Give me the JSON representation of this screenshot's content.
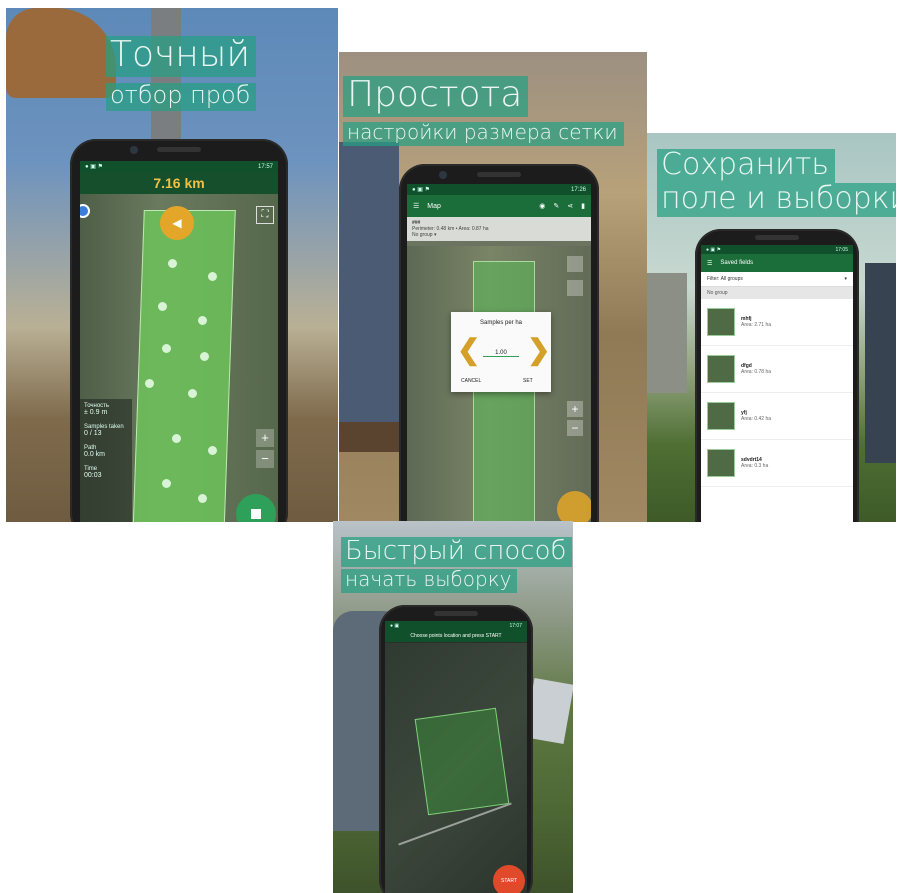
{
  "panel1": {
    "title_line1": "Точный",
    "title_line2": "отбор проб",
    "status_time": "17:57",
    "distance": "7.16 km",
    "stats": [
      {
        "label": "Точность",
        "value": "± 0.9 m"
      },
      {
        "label": "Samples taken",
        "value": "0 / 13"
      },
      {
        "label": "Path",
        "value": "0.0 km"
      },
      {
        "label": "Time",
        "value": "00:03"
      }
    ],
    "zoom_in": "+",
    "zoom_out": "−"
  },
  "panel2": {
    "title_line1": "Простота",
    "title_line2": "настройки размера сетки",
    "status_time": "17:26",
    "appbar_title": "Map",
    "info_name": "###",
    "info_line": "Perimeter: 0.48 km • Area: 0.87 ha",
    "info_group": "No group ▾",
    "dialog_title": "Samples per ha",
    "dialog_value": "1.00",
    "dialog_cancel": "CANCEL",
    "dialog_set": "SET",
    "zoom_in": "+",
    "zoom_out": "−"
  },
  "panel3": {
    "title_line1": "Сохранить",
    "title_line2": "поле и выборки",
    "status_time": "17:05",
    "appbar_title": "Saved fields",
    "filter_label": "Filter:",
    "filter_value": "All groups",
    "group_header": "No group",
    "fields": [
      {
        "name": "mhfj",
        "area": "Area: 2.71 ha"
      },
      {
        "name": "dfgd",
        "area": "Area: 0.78 ha"
      },
      {
        "name": "yfj",
        "area": "Area: 0.42 ha"
      },
      {
        "name": "sdvdrt14",
        "area": "Area: 0.3 ha"
      }
    ]
  },
  "panel4": {
    "title_line1": "Быстрый способ",
    "title_line2": "начать выборку",
    "status_time": "17:07",
    "hint": "Choose points location and press START",
    "start_label": "START"
  },
  "colors": {
    "accent_green": "#1b6e3a",
    "heading_bg": "#26a082",
    "orange": "#e3a628",
    "start_red": "#e04a2b"
  }
}
